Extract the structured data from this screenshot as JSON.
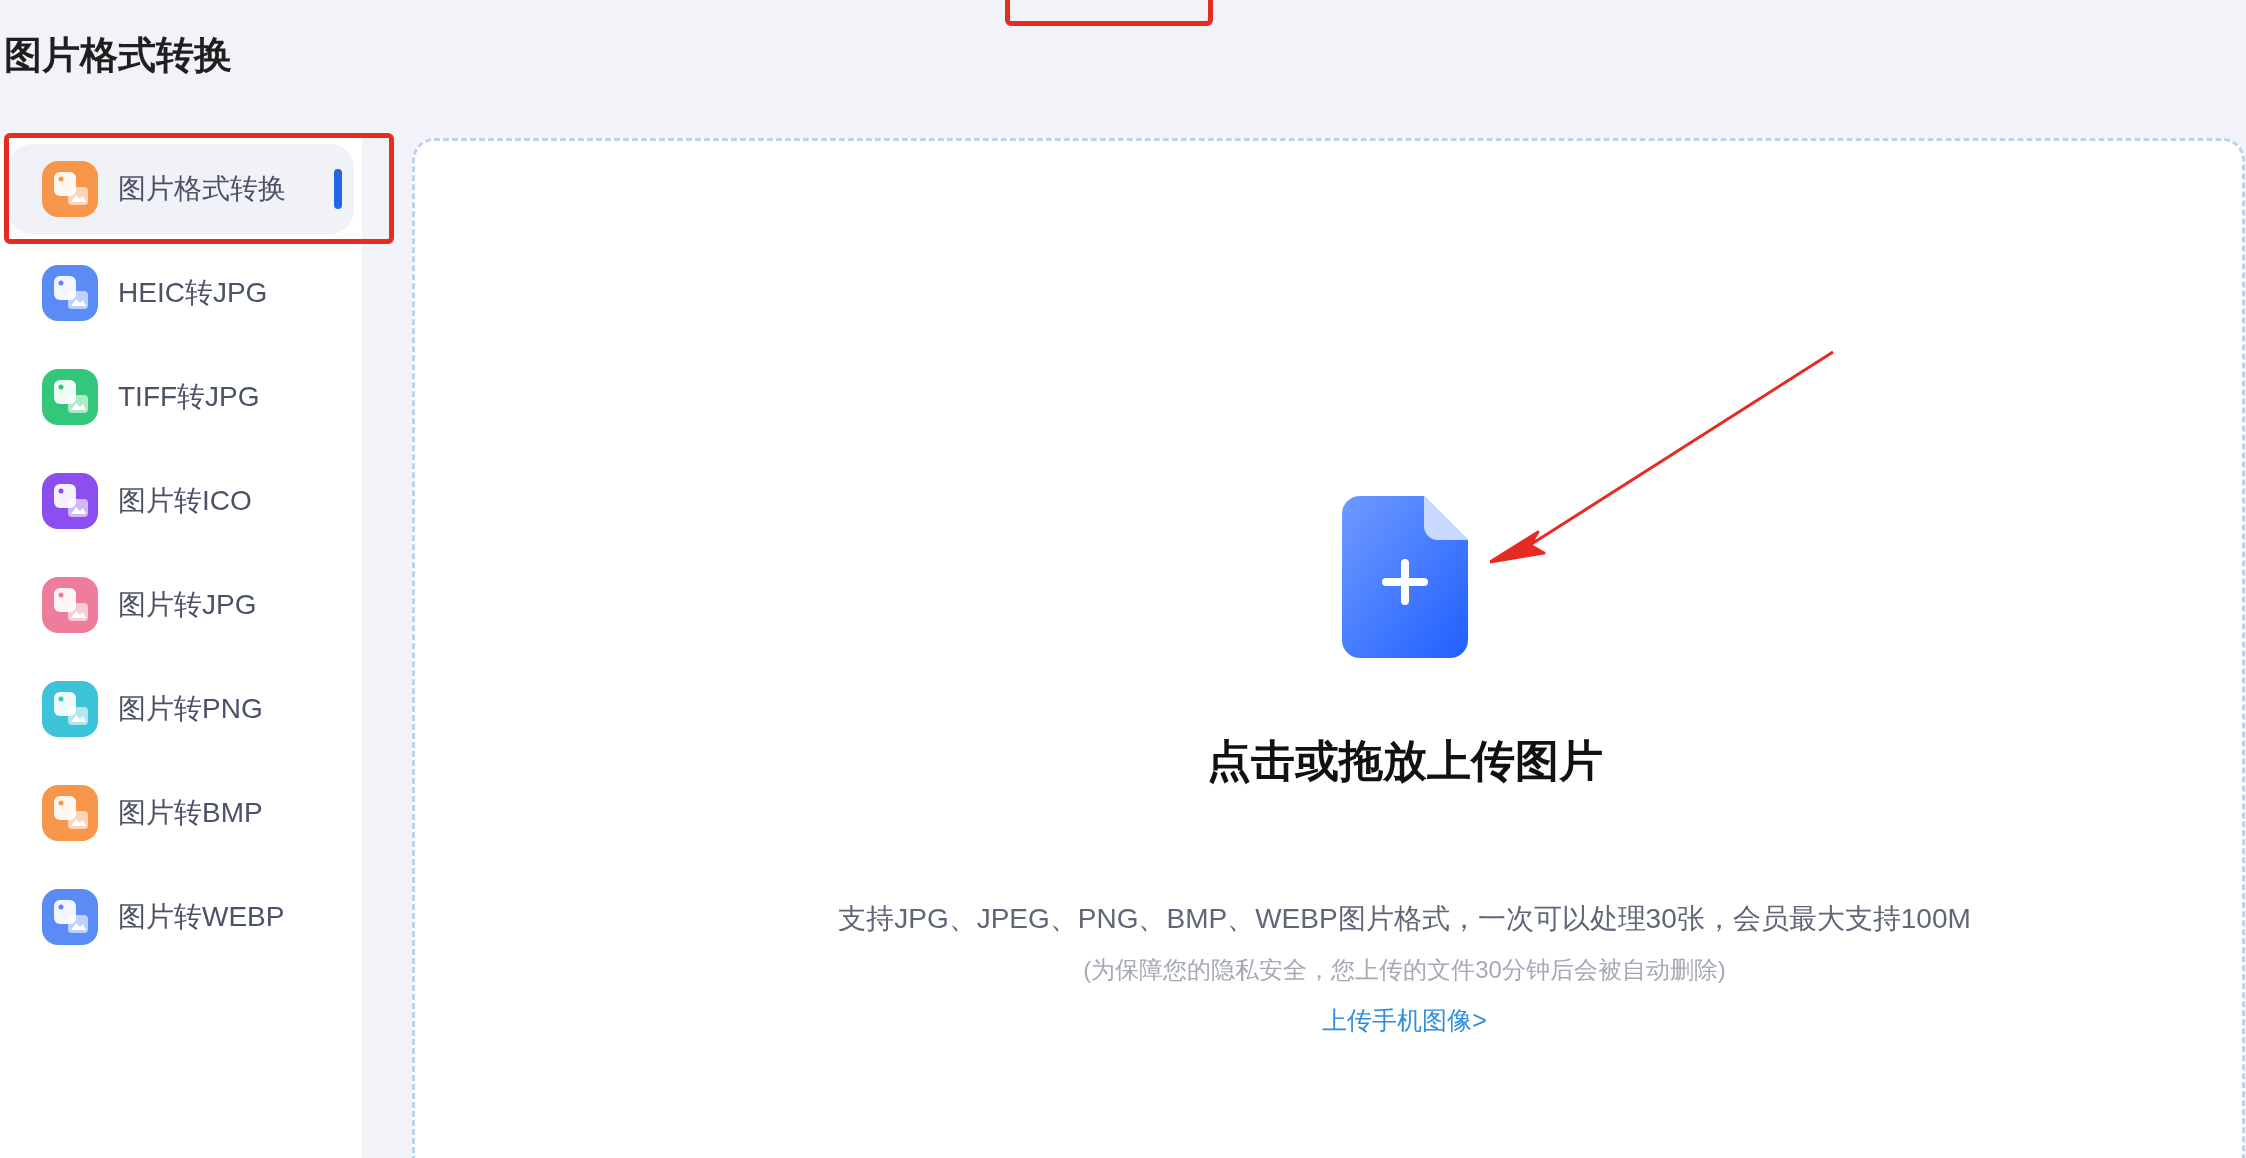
{
  "page_title": "图片格式转换",
  "sidebar": {
    "items": [
      {
        "label": "图片格式转换",
        "selected": true,
        "color": "#f7954a"
      },
      {
        "label": "HEIC转JPG",
        "selected": false,
        "color": "#5b8cf5"
      },
      {
        "label": "TIFF转JPG",
        "selected": false,
        "color": "#34c77b"
      },
      {
        "label": "图片转ICO",
        "selected": false,
        "color": "#8b4ff0"
      },
      {
        "label": "图片转JPG",
        "selected": false,
        "color": "#ee7d9c"
      },
      {
        "label": "图片转PNG",
        "selected": false,
        "color": "#3cc3d8"
      },
      {
        "label": "图片转BMP",
        "selected": false,
        "color": "#f7954a"
      },
      {
        "label": "图片转WEBP",
        "selected": false,
        "color": "#5b8cf5"
      }
    ]
  },
  "upload": {
    "title": "点击或拖放上传图片",
    "description": "支持JPG、JPEG、PNG、BMP、WEBP图片格式，一次可以处理30张，会员最大支持100M",
    "privacy_note": "(为保障您的隐私安全，您上传的文件30分钟后会被自动删除)",
    "mobile_link": "上传手机图像>"
  }
}
